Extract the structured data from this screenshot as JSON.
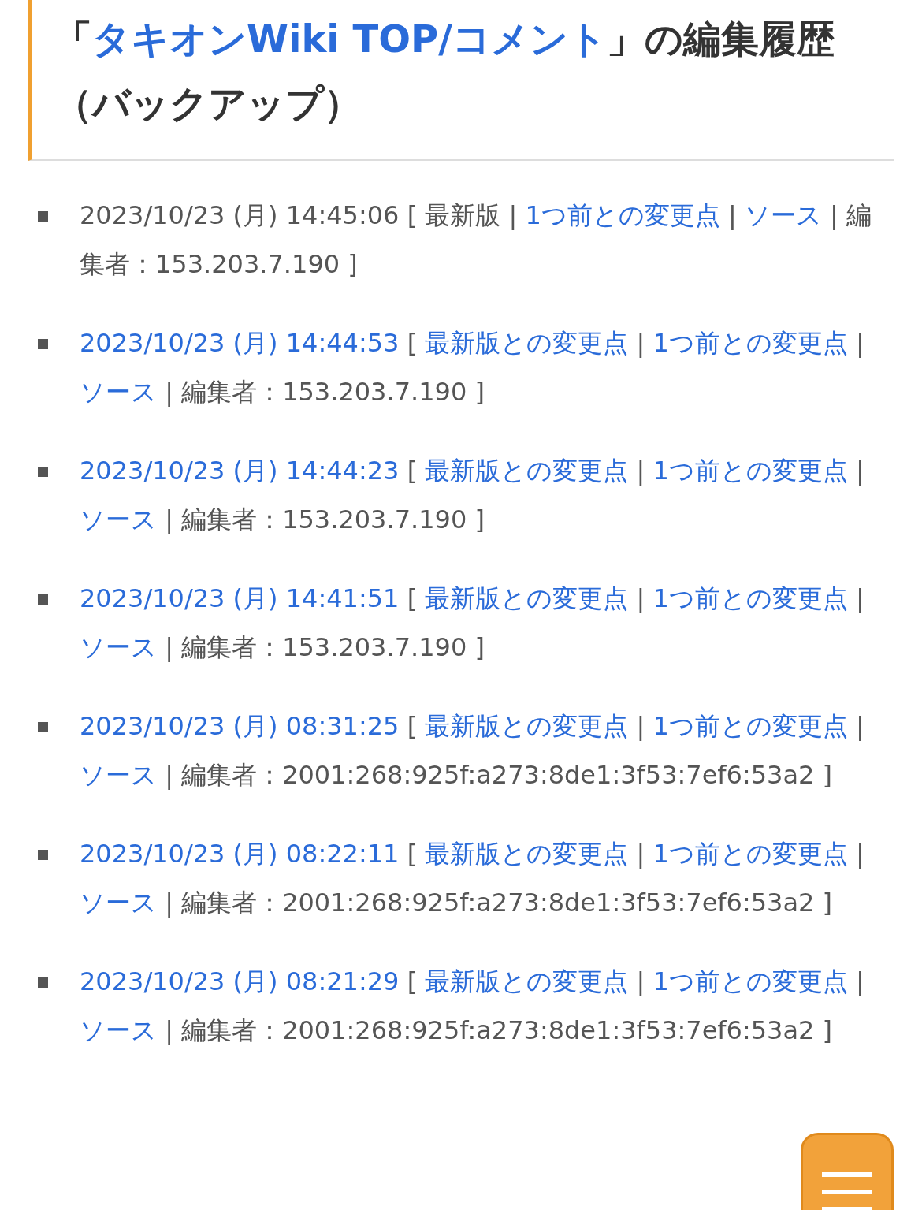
{
  "heading": {
    "prefix": "「",
    "link": "タキオンWiki TOP/コメント",
    "suffix": "」の編集履歴（バックアップ）"
  },
  "entries": [
    {
      "segments": [
        {
          "text": "2023/10/23 (月) 14:45:06",
          "link": false
        },
        {
          "text": "[",
          "link": false
        },
        {
          "text": "最新版",
          "link": false
        },
        {
          "text": "|",
          "link": false
        },
        {
          "text": "1つ前との変更点",
          "link": true
        },
        {
          "text": "|",
          "link": false
        },
        {
          "text": "ソース",
          "link": true
        },
        {
          "text": "|",
          "link": false
        },
        {
          "text": "編集者：153.203.7.190",
          "link": false
        },
        {
          "text": "]",
          "link": false
        }
      ]
    },
    {
      "segments": [
        {
          "text": "2023/10/23 (月) 14:44:53",
          "link": true
        },
        {
          "text": "[",
          "link": false
        },
        {
          "text": "最新版との変更点",
          "link": true
        },
        {
          "text": "|",
          "link": false
        },
        {
          "text": "1つ前との変更点",
          "link": true
        },
        {
          "text": "|",
          "link": false
        },
        {
          "text": "ソース",
          "link": true
        },
        {
          "text": "|",
          "link": false
        },
        {
          "text": "編集者：153.203.7.190",
          "link": false
        },
        {
          "text": "]",
          "link": false
        }
      ]
    },
    {
      "segments": [
        {
          "text": "2023/10/23 (月) 14:44:23",
          "link": true
        },
        {
          "text": "[",
          "link": false
        },
        {
          "text": "最新版との変更点",
          "link": true
        },
        {
          "text": "|",
          "link": false
        },
        {
          "text": "1つ前との変更点",
          "link": true
        },
        {
          "text": "|",
          "link": false
        },
        {
          "text": "ソース",
          "link": true
        },
        {
          "text": "|",
          "link": false
        },
        {
          "text": "編集者：153.203.7.190",
          "link": false
        },
        {
          "text": "]",
          "link": false
        }
      ]
    },
    {
      "segments": [
        {
          "text": "2023/10/23 (月) 14:41:51",
          "link": true
        },
        {
          "text": "[",
          "link": false
        },
        {
          "text": "最新版との変更点",
          "link": true
        },
        {
          "text": "|",
          "link": false
        },
        {
          "text": "1つ前との変更点",
          "link": true
        },
        {
          "text": "|",
          "link": false
        },
        {
          "text": "ソース",
          "link": true
        },
        {
          "text": "|",
          "link": false
        },
        {
          "text": "編集者：153.203.7.190",
          "link": false
        },
        {
          "text": "]",
          "link": false
        }
      ]
    },
    {
      "segments": [
        {
          "text": "2023/10/23 (月) 08:31:25",
          "link": true
        },
        {
          "text": "[",
          "link": false
        },
        {
          "text": "最新版との変更点",
          "link": true
        },
        {
          "text": "|",
          "link": false
        },
        {
          "text": "1つ前との変更点",
          "link": true
        },
        {
          "text": "|",
          "link": false
        },
        {
          "text": "ソース",
          "link": true
        },
        {
          "text": "|",
          "link": false
        },
        {
          "text": "編集者：2001:268:925f:a273:8de1:3f53:7ef6:53a2",
          "link": false
        },
        {
          "text": "]",
          "link": false
        }
      ]
    },
    {
      "segments": [
        {
          "text": "2023/10/23 (月) 08:22:11",
          "link": true
        },
        {
          "text": "[",
          "link": false
        },
        {
          "text": "最新版との変更点",
          "link": true
        },
        {
          "text": "|",
          "link": false
        },
        {
          "text": "1つ前との変更点",
          "link": true
        },
        {
          "text": "|",
          "link": false
        },
        {
          "text": "ソース",
          "link": true
        },
        {
          "text": "|",
          "link": false
        },
        {
          "text": "編集者：2001:268:925f:a273:8de1:3f53:7ef6:53a2",
          "link": false
        },
        {
          "text": "]",
          "link": false
        }
      ]
    },
    {
      "segments": [
        {
          "text": "2023/10/23 (月) 08:21:29",
          "link": true
        },
        {
          "text": "[",
          "link": false
        },
        {
          "text": "最新版との変更点",
          "link": true
        },
        {
          "text": "|",
          "link": false
        },
        {
          "text": "1つ前との変更点",
          "link": true
        },
        {
          "text": "|",
          "link": false
        },
        {
          "text": "ソース",
          "link": true
        },
        {
          "text": "|",
          "link": false
        },
        {
          "text": "編集者：2001:268:925f:a273:8de1:3f53:7ef6:53a2",
          "link": false
        },
        {
          "text": "]",
          "link": false
        }
      ]
    }
  ]
}
